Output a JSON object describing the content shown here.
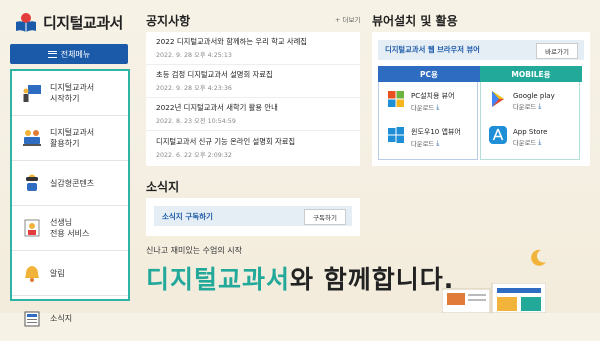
{
  "logo": {
    "title": "디지털교과서"
  },
  "menu": {
    "label": "전체메뉴"
  },
  "sidebar": {
    "items": [
      {
        "label": "디지털교과서\n시작하기",
        "icon": "teacher-board-icon"
      },
      {
        "label": "디지털교과서\n활용하기",
        "icon": "people-laptop-icon"
      },
      {
        "label": "실감형콘텐츠",
        "icon": "vr-headset-icon"
      },
      {
        "label": "선생님\n전용 서비스",
        "icon": "teacher-service-icon"
      },
      {
        "label": "알림",
        "icon": "bell-icon"
      },
      {
        "label": "소식지",
        "icon": "newspaper-icon"
      }
    ]
  },
  "notices": {
    "heading": "공지사항",
    "more": "+ 더보기",
    "items": [
      {
        "title": "2022 디지털교과서와 함께하는 우리 학교 사례집",
        "date": "2022. 9. 28 오후 4:25:13"
      },
      {
        "title": "초등 검정 디지털교과서 설명회 자료집",
        "date": "2022. 9. 28 오후 4:23:36"
      },
      {
        "title": "2022년 디지털교과서 새학기 활용 안내",
        "date": "2022. 8. 23 오전 10:54:59"
      },
      {
        "title": "디지털교과서 신규 기능 온라인 설명회 자료집",
        "date": "2022. 6. 22 오후 2:09:32"
      }
    ]
  },
  "news": {
    "heading": "소식지",
    "subscribe_label": "소식지 구독하기",
    "subscribe_button": "구독하기"
  },
  "install": {
    "heading": "뷰어설치 및 활용",
    "web_label": "디지털교과서 웹 브라우저 뷰어",
    "web_button": "바로가기",
    "pc_tab": "PC용",
    "mobile_tab": "MOBILE용",
    "pc": [
      {
        "name": "PC설치용 뷰어",
        "action": "다운로드",
        "icon": "windows-xp-icon"
      },
      {
        "name": "윈도우10 앱뷰어",
        "action": "다운로드",
        "icon": "windows-10-icon"
      }
    ],
    "mobile": [
      {
        "name": "Google play",
        "action": "다운로드",
        "icon": "google-play-icon"
      },
      {
        "name": "App Store",
        "action": "다운로드",
        "icon": "app-store-icon"
      }
    ]
  },
  "banner": {
    "tagline": "신나고 재미있는 수업의 시작",
    "slogan_highlight": "디지털교과서",
    "slogan_rest": "와 함께합니다."
  },
  "colors": {
    "primary": "#1b5aa8",
    "teal": "#22a99a",
    "accent": "#f2b33a"
  }
}
